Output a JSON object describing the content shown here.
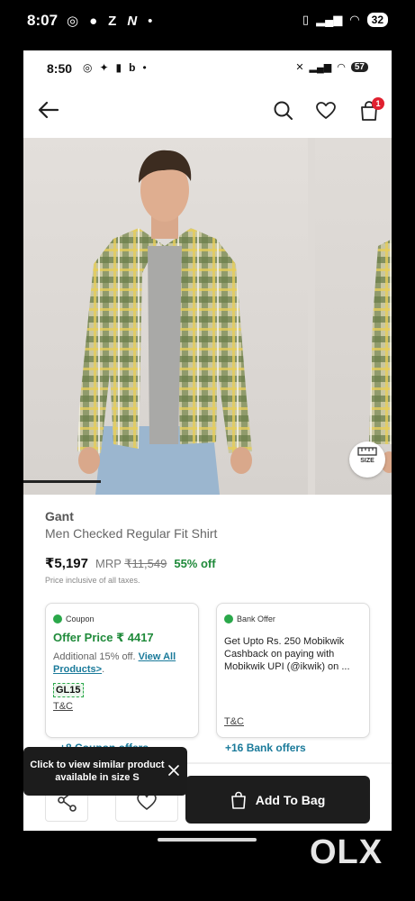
{
  "outer_status": {
    "time": "8:07",
    "battery": "32"
  },
  "inner_status": {
    "time": "8:50",
    "battery": "57"
  },
  "header": {
    "cart_badge": "1"
  },
  "gallery": {
    "size_label": "SIZE"
  },
  "product": {
    "brand": "Gant",
    "name": "Men Checked Regular Fit Shirt",
    "price": "₹5,197",
    "mrp_label": "MRP",
    "mrp_value": "₹11,549",
    "discount": "55% off",
    "tax_note": "Price inclusive of all taxes."
  },
  "coupon_card": {
    "tag": "Coupon",
    "offer_price": "Offer Price ₹ 4417",
    "additional": "Additional 15% off.",
    "link": "View All Products>",
    "link_suffix": ".",
    "code": "GL15",
    "tc": "T&C"
  },
  "bank_card": {
    "tag": "Bank Offer",
    "text": "Get Upto Rs. 250 Mobikwik Cashback on paying with Mobikwik UPI (@ikwik) on ...",
    "tc": "T&C",
    "more": "+16 Bank offers"
  },
  "coupon_more": "+8 Coupon offers",
  "toast": {
    "text": "Click to view similar product available in size S"
  },
  "bottom": {
    "add_to_bag": "Add To Bag"
  },
  "watermark": "OLX",
  "colors": {
    "accent_green": "#1f8a3a",
    "link_teal": "#1a7a9a",
    "badge_red": "#e0202f",
    "bag_button": "#1d1d1d"
  }
}
